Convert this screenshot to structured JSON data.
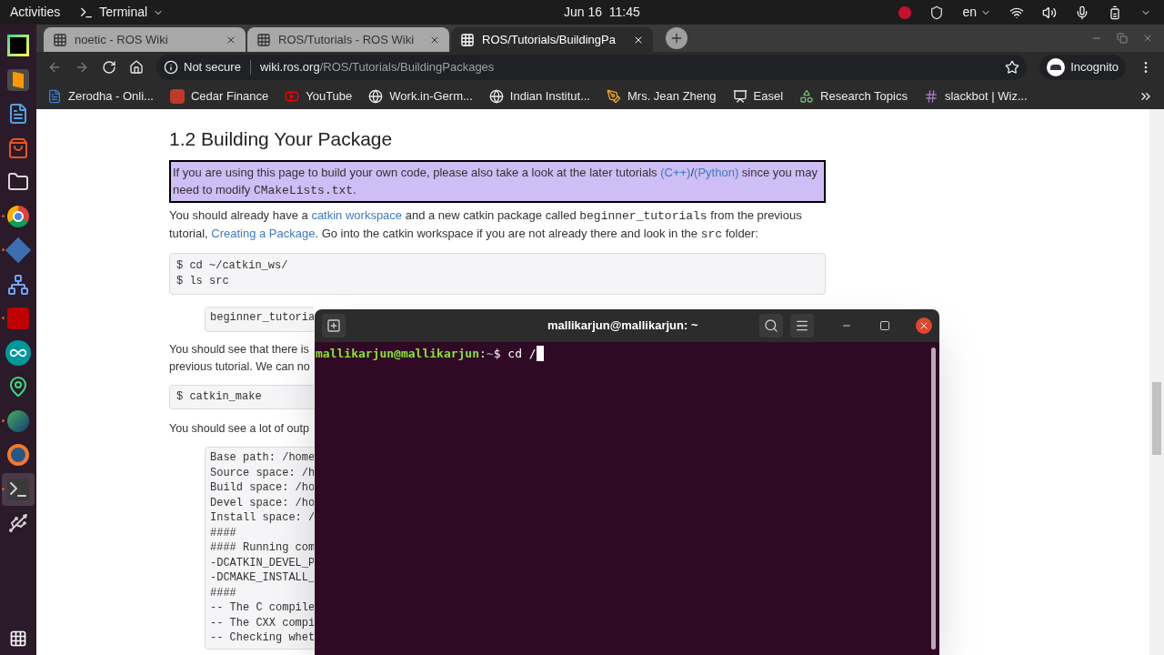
{
  "top_bar": {
    "activities": "Activities",
    "app_menu": "Terminal",
    "clock": "Jun 16  11:45",
    "keyboard": "en"
  },
  "dock": {
    "items": [
      {
        "kind": "pycharm",
        "running": false,
        "selected": false
      },
      {
        "kind": "sublime",
        "running": false,
        "selected": false
      },
      {
        "kind": "writer",
        "running": false,
        "selected": false
      },
      {
        "kind": "store",
        "running": false,
        "selected": false
      },
      {
        "kind": "files",
        "running": false,
        "selected": false
      },
      {
        "kind": "chrome",
        "running": true,
        "selected": false
      },
      {
        "kind": "code",
        "running": true,
        "selected": false
      },
      {
        "kind": "network",
        "running": false,
        "selected": false
      },
      {
        "kind": "filezilla",
        "running": true,
        "selected": false
      },
      {
        "kind": "arduino",
        "running": false,
        "selected": false
      },
      {
        "kind": "maps",
        "running": false,
        "selected": false
      },
      {
        "kind": "globe",
        "running": true,
        "selected": false
      },
      {
        "kind": "blender",
        "running": false,
        "selected": false
      },
      {
        "kind": "terminal",
        "running": true,
        "selected": true
      },
      {
        "kind": "usb",
        "running": false,
        "selected": false
      }
    ]
  },
  "browser": {
    "tabs": [
      {
        "title": "noetic - ROS Wiki",
        "selected": false
      },
      {
        "title": "ROS/Tutorials - ROS Wiki",
        "selected": false
      },
      {
        "title": "ROS/Tutorials/BuildingPa",
        "selected": true
      }
    ],
    "address": {
      "security": "Not secure",
      "host": "wiki.ros.org",
      "path": "/ROS/Tutorials/BuildingPackages"
    },
    "profile": "Incognito",
    "bookmarks": [
      {
        "label": "Zerodha - Onli...",
        "kind": "doc"
      },
      {
        "label": "Cedar Finance",
        "kind": "finance"
      },
      {
        "label": "YouTube",
        "kind": "video"
      },
      {
        "label": "Work.in-Germ...",
        "kind": "globe"
      },
      {
        "label": "Indian Institut...",
        "kind": "globe"
      },
      {
        "label": "Mrs. Jean Zheng",
        "kind": "pen"
      },
      {
        "label": "Easel",
        "kind": "easel"
      },
      {
        "label": "Research Topics",
        "kind": "shapes"
      },
      {
        "label": "slackbot | Wiz...",
        "kind": "hash"
      }
    ]
  },
  "page": {
    "heading": "1.2 Building Your Package",
    "note": [
      {
        "kind": "text",
        "text": "If you are using this page to build your own code, please also take a look at the later tutorials "
      },
      {
        "kind": "link",
        "text": "(C++)"
      },
      {
        "kind": "text",
        "text": "/"
      },
      {
        "kind": "link",
        "text": "(Python)"
      },
      {
        "kind": "text",
        "text": " since you may need to modify "
      },
      {
        "kind": "code",
        "text": "CMakeLists.txt"
      },
      {
        "kind": "text",
        "text": "."
      }
    ],
    "intro": [
      {
        "kind": "text",
        "text": "You should already have a "
      },
      {
        "kind": "link",
        "text": "catkin workspace"
      },
      {
        "kind": "text",
        "text": " and a new catkin package called "
      },
      {
        "kind": "code",
        "text": "beginner_tutorials"
      },
      {
        "kind": "text",
        "text": " from the previous tutorial, "
      },
      {
        "kind": "link",
        "text": "Creating a Package"
      },
      {
        "kind": "text",
        "text": ". Go into the catkin workspace if you are not already there and look in the "
      },
      {
        "kind": "code",
        "text": "src"
      },
      {
        "kind": "text",
        "text": " folder:"
      }
    ],
    "command_1": [
      "$ cd ~/catkin_ws/",
      "$ ls src"
    ],
    "output_1": "beginner_tutoria",
    "para_2": [
      "You should see that there is",
      "previous tutorial. We can no"
    ],
    "command_2": [
      "$ catkin_make"
    ],
    "para_3": "You should see a lot of outp",
    "output_2": [
      "Base path: /home",
      "Source space: /h",
      "Build space: /ho",
      "Devel space: /ho",
      "Install space: /",
      "####",
      "#### Running com",
      "-DCATKIN_DEVEL_P",
      "-DCMAKE_INSTALL_",
      "####",
      "-- The C compile",
      "-- The CXX compi",
      "-- Checking whet"
    ]
  },
  "terminal": {
    "title": "mallikarjun@mallikarjun: ~",
    "user_host": "mallikarjun@mallikarjun",
    "colon": ":",
    "cwd": "~",
    "command": "$ cd /"
  }
}
